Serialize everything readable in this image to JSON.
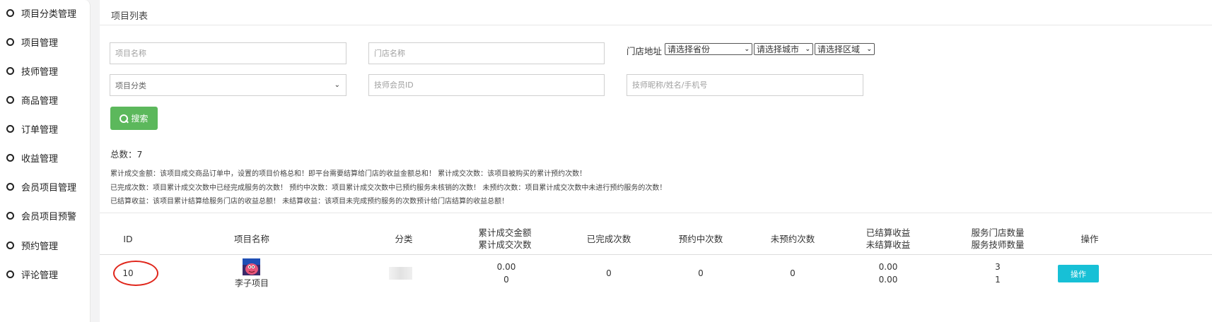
{
  "sidebar": {
    "items": [
      {
        "label": "项目分类管理"
      },
      {
        "label": "项目管理"
      },
      {
        "label": "技师管理"
      },
      {
        "label": "商品管理"
      },
      {
        "label": "订单管理"
      },
      {
        "label": "收益管理"
      },
      {
        "label": "会员项目管理"
      },
      {
        "label": "会员项目预警"
      },
      {
        "label": "预约管理"
      },
      {
        "label": "评论管理"
      }
    ]
  },
  "panel": {
    "title": "项目列表"
  },
  "filters": {
    "project_name_placeholder": "项目名称",
    "store_name_placeholder": "门店名称",
    "store_address_label": "门店地址",
    "province_select": "请选择省份",
    "city_select": "请选择城市",
    "district_select": "请选择区域",
    "category_select": "项目分类",
    "tech_member_id_placeholder": "技师会员ID",
    "tech_search_placeholder": "技师昵称/姓名/手机号",
    "search_label": "搜索"
  },
  "summary": {
    "total": "总数：7",
    "notes": [
      "累计成交金额：该项目成交商品订单中，设置的项目价格总和！即平台需要结算给门店的收益金额总和！  累计成交次数：该项目被购买的累计预约次数！",
      "已完成次数：项目累计成交次数中已经完成服务的次数！  预约中次数：项目累计成交次数中已预约服务未核销的次数！  未预约次数：项目累计成交次数中未进行预约服务的次数！",
      "已结算收益：该项目累计结算给服务门店的收益总额！  未结算收益：该项目未完成预约服务的次数预计给门店结算的收益总额！"
    ]
  },
  "table": {
    "headers": {
      "id": "ID",
      "name": "项目名称",
      "category": "分类",
      "amount_line1": "累计成交金额",
      "amount_line2": "累计成交次数",
      "completed": "已完成次数",
      "reserved": "预约中次数",
      "unreserved": "未预约次数",
      "income_line1": "已结算收益",
      "income_line2": "未结算收益",
      "store_line1": "服务门店数量",
      "store_line2": "服务技师数量",
      "ops": "操作"
    },
    "rows": [
      {
        "id": "10",
        "name": "李子项目",
        "category": "",
        "amount": "0.00",
        "count": "0",
        "completed": "0",
        "reserved": "0",
        "unreserved": "0",
        "settled": "0.00",
        "unsettled": "0.00",
        "stores": "3",
        "techs": "1",
        "action": "操作"
      }
    ]
  },
  "colors": {
    "search_button": "#5cb85c",
    "action_button": "#17c0d6",
    "highlight_circle": "#e0261b"
  }
}
